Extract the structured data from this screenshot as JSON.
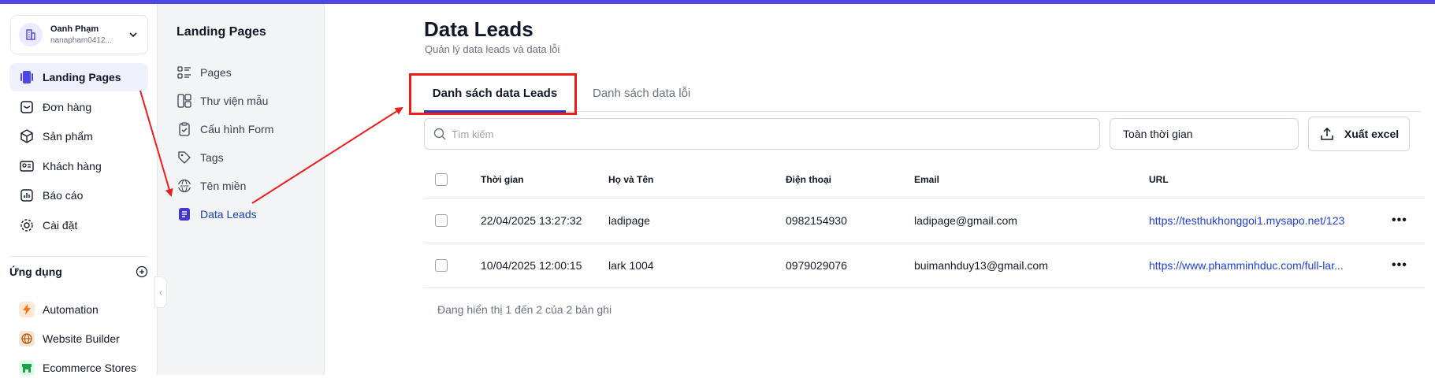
{
  "account": {
    "name": "Oanh Phạm",
    "email": "nanapham0412..."
  },
  "sidebar": {
    "items": [
      {
        "label": "Landing Pages",
        "icon": "landing-pages-icon",
        "active": true
      },
      {
        "label": "Đơn hàng",
        "icon": "orders-icon"
      },
      {
        "label": "Sản phẩm",
        "icon": "box-icon"
      },
      {
        "label": "Khách hàng",
        "icon": "customer-card-icon"
      },
      {
        "label": "Báo cáo",
        "icon": "report-chart-icon"
      },
      {
        "label": "Cài đặt",
        "icon": "gear-icon"
      }
    ],
    "apps_header": "Ứng dụng",
    "apps": [
      {
        "label": "Automation",
        "icon": "lightning-icon",
        "color": "#f97316"
      },
      {
        "label": "Website Builder",
        "icon": "globe-icon",
        "color": "#b45309"
      },
      {
        "label": "Ecommerce Stores",
        "icon": "store-icon",
        "color": "#16a34a"
      }
    ]
  },
  "subbar": {
    "title": "Landing Pages",
    "items": [
      {
        "label": "Pages",
        "icon": "list-icon"
      },
      {
        "label": "Thư viện mẫu",
        "icon": "template-icon"
      },
      {
        "label": "Cấu hình Form",
        "icon": "clipboard-check-icon"
      },
      {
        "label": "Tags",
        "icon": "tag-icon"
      },
      {
        "label": "Tên miền",
        "icon": "www-globe-icon"
      },
      {
        "label": "Data Leads",
        "icon": "document-icon",
        "active": true
      }
    ]
  },
  "main": {
    "title": "Data Leads",
    "subtitle": "Quản lý data leads và data lỗi",
    "tabs": [
      {
        "label": "Danh sách data Leads",
        "active": true
      },
      {
        "label": "Danh sách data lỗi"
      }
    ],
    "search_placeholder": "Tìm kiếm",
    "range_label": "Toàn thời gian",
    "export_label": "Xuất excel",
    "table": {
      "columns": [
        "Thời gian",
        "Họ và Tên",
        "Điện thoại",
        "Email",
        "URL"
      ],
      "rows": [
        {
          "time": "22/04/2025 13:27:32",
          "name": "ladipage",
          "phone": "0982154930",
          "email": "ladipage@gmail.com",
          "url": "https://testhukhonggoi1.mysapo.net/123",
          "more": "•••"
        },
        {
          "time": "10/04/2025 12:00:15",
          "name": "lark 1004",
          "phone": "0979029076",
          "email": "buimanhduy13@gmail.com",
          "url": "https://www.phamminhduc.com/full-lar...",
          "more": "•••"
        }
      ]
    },
    "footer": "Đang hiển thị 1 đến 2 của 2 bản ghi"
  },
  "colors": {
    "accent": "#4f46e5",
    "tab_underline": "#2d3ab1",
    "link": "#1d3ed8",
    "annotation": "#ef1c1c"
  }
}
